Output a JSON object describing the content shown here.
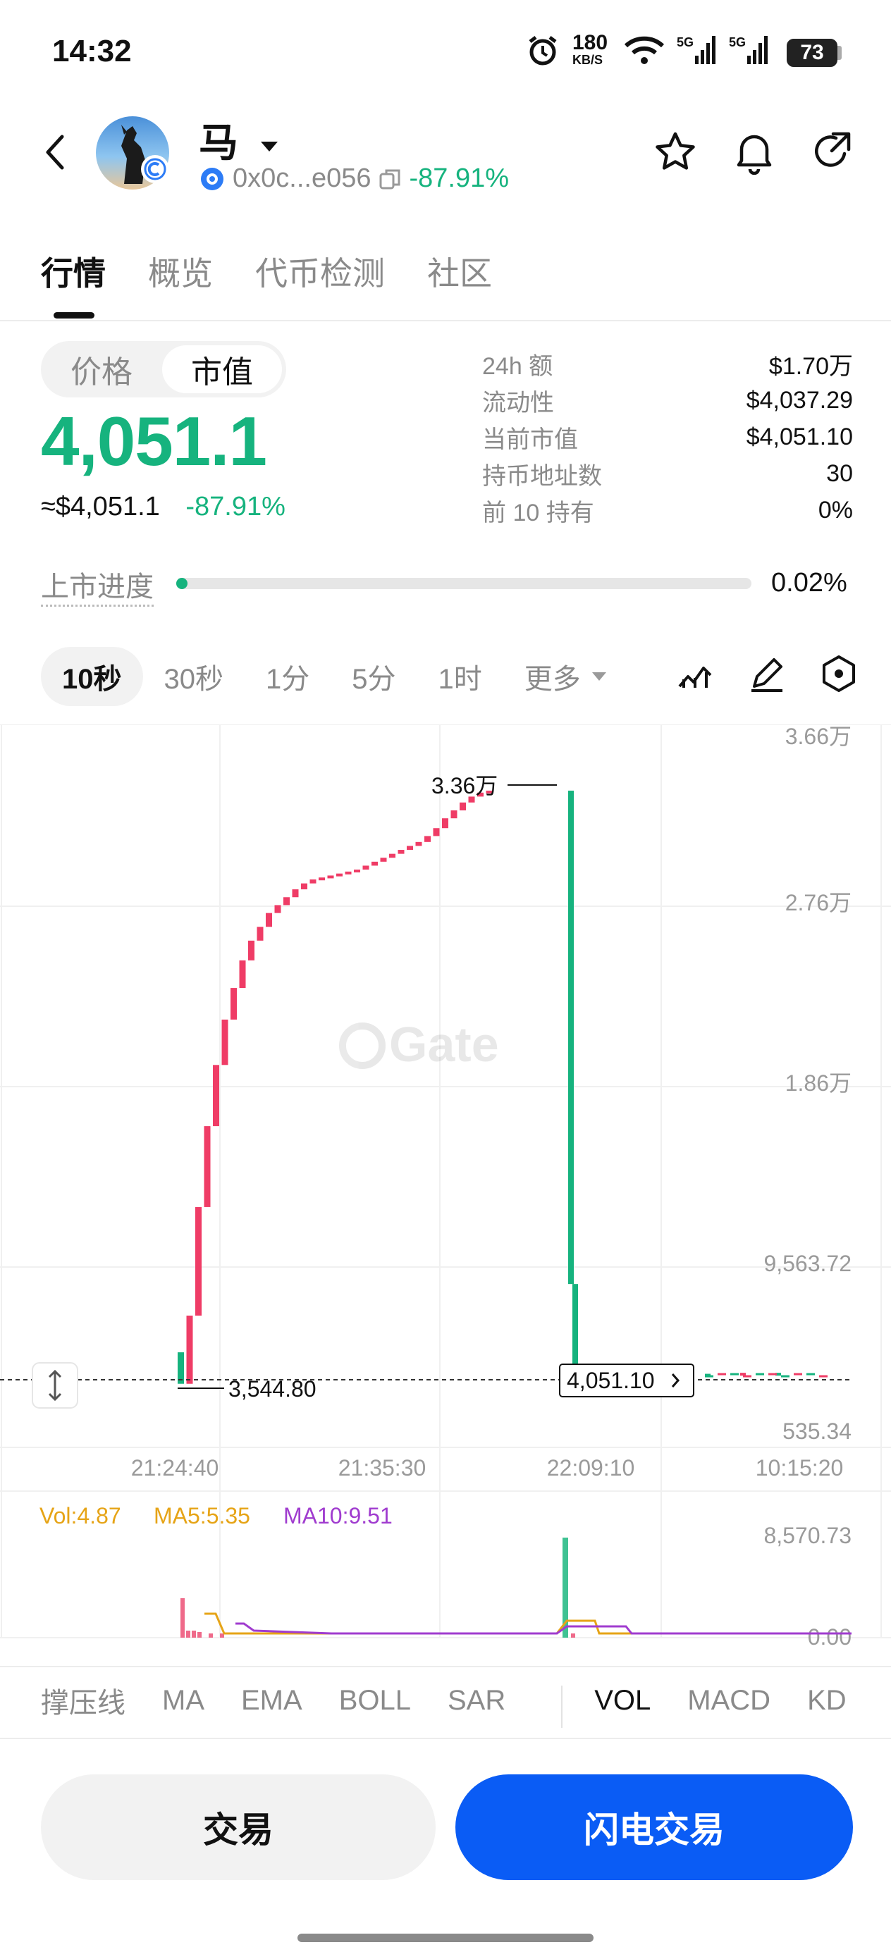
{
  "status_bar": {
    "time": "14:32",
    "net_speed_value": "180",
    "net_speed_unit": "KB/S",
    "signal1": "5G",
    "signal2": "5G",
    "battery": "73"
  },
  "header": {
    "token_name": "马",
    "address": "0x0c...e056",
    "change": "-87.91%"
  },
  "tabs": [
    "行情",
    "概览",
    "代币检测",
    "社区"
  ],
  "price_block": {
    "segments": [
      "价格",
      "市值"
    ],
    "active_segment": "市值",
    "value": "4,051.1",
    "usd": "≈$4,051.1",
    "change": "-87.91%"
  },
  "stats": [
    {
      "label": "24h  额",
      "value": "$1.70万"
    },
    {
      "label": "流动性",
      "value": "$4,037.29"
    },
    {
      "label": "当前市值",
      "value": "$4,051.10"
    },
    {
      "label": "持币地址数",
      "value": "30"
    },
    {
      "label": "前 10 持有",
      "value": "0%"
    }
  ],
  "listing_progress": {
    "label": "上市进度",
    "value": "0.02%",
    "fraction": 0.02
  },
  "intervals": [
    "10秒",
    "30秒",
    "1分",
    "5分",
    "1时",
    "更多"
  ],
  "active_interval": "10秒",
  "chart_data": {
    "type": "candlestick",
    "y_axis_labels": [
      "3.66万",
      "2.76万",
      "1.86万",
      "9,563.72",
      "535.34"
    ],
    "x_axis_labels": [
      "21:24:40",
      "21:35:30",
      "22:09:10",
      "10:15:20"
    ],
    "annotations": {
      "high": "3.36万",
      "low": "3,544.80",
      "current": "4,051.10"
    },
    "watermark": "Gate",
    "closes": [
      3544.8,
      7000,
      12500,
      16600,
      19700,
      22000,
      23600,
      25000,
      26000,
      26700,
      27400,
      27800,
      28200,
      28600,
      28900,
      29100,
      29200,
      29300,
      29400,
      29500,
      29600,
      29800,
      30000,
      30200,
      30400,
      30600,
      30800,
      31000,
      31300,
      31700,
      32200,
      32600,
      33000,
      33300,
      33500,
      33600,
      8600,
      4051.1,
      4000,
      4100,
      4051.1
    ],
    "volume": {
      "vol": "Vol:4.87",
      "ma5": "MA5:5.35",
      "ma10": "MA10:9.51",
      "max_label": "8,570.73",
      "min_label": "0.00"
    }
  },
  "indicators": [
    "撑压线",
    "MA",
    "EMA",
    "BOLL",
    "SAR",
    "VOL",
    "MACD",
    "KD"
  ],
  "active_indicator": "VOL",
  "buttons": {
    "trade": "交易",
    "flash_trade": "闪电交易"
  },
  "colors": {
    "up": "#ef3c66",
    "down": "#16b37e",
    "accent": "#0a5cf5"
  }
}
